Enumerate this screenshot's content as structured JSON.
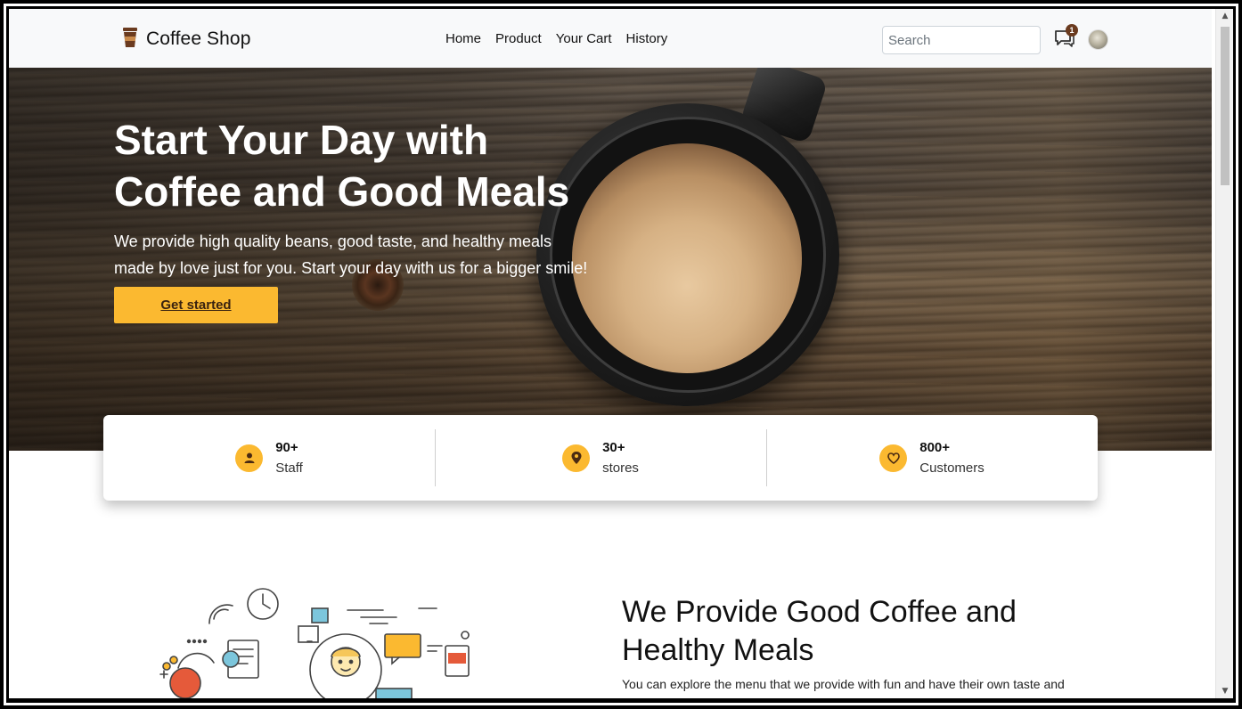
{
  "navbar": {
    "brand": "Coffee Shop",
    "links": [
      "Home",
      "Product",
      "Your Cart",
      "History"
    ],
    "search_placeholder": "Search",
    "chat_badge": "1"
  },
  "hero": {
    "title_line1": "Start Your Day with",
    "title_line2": "Coffee and Good Meals",
    "subtitle_line1": "We provide high quality beans, good taste, and healthy meals",
    "subtitle_line2": "made by love just for you. Start your day with us for a bigger smile!",
    "cta": "Get started"
  },
  "stats": [
    {
      "value": "90+",
      "label": "Staff",
      "icon": "user-icon"
    },
    {
      "value": "30+",
      "label": "stores",
      "icon": "location-pin-icon"
    },
    {
      "value": "800+",
      "label": "Customers",
      "icon": "heart-icon"
    }
  ],
  "about": {
    "title_line1": "We Provide Good Coffee and",
    "title_line2": "Healthy Meals",
    "text": "You can explore the menu that we provide with fun and have their own taste and"
  },
  "colors": {
    "accent": "#fbb930",
    "brand_brown": "#6b3b1f",
    "navbar_bg": "#f8f9fa"
  }
}
